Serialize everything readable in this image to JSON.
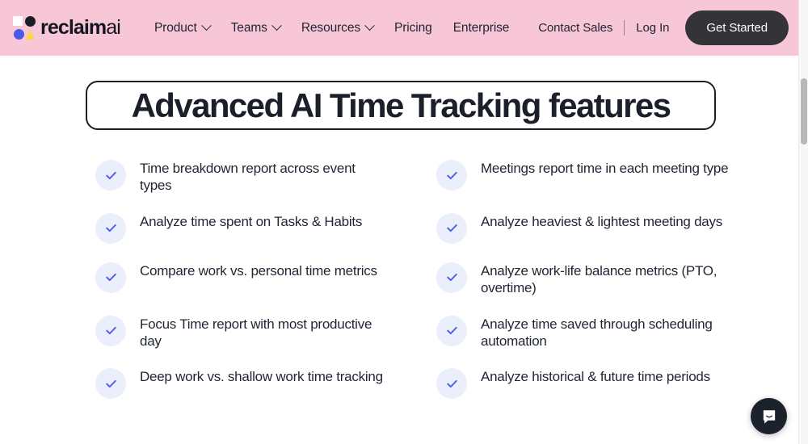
{
  "header": {
    "background_color": "#f7c6d7",
    "logo": {
      "name": "reclaim",
      "suffix": "ai",
      "mark_colors": {
        "square": "#ffffff",
        "circle_dark": "#1a1d26",
        "circle_blue": "#4a5ae8",
        "triangle": "#ffd24d"
      }
    },
    "nav_links": [
      {
        "label": "Product",
        "has_dropdown": true
      },
      {
        "label": "Teams",
        "has_dropdown": true
      },
      {
        "label": "Resources",
        "has_dropdown": true
      },
      {
        "label": "Pricing",
        "has_dropdown": false
      },
      {
        "label": "Enterprise",
        "has_dropdown": false
      }
    ],
    "actions": {
      "contact_sales": "Contact Sales",
      "log_in": "Log In",
      "get_started": "Get Started",
      "cta_background": "#333338"
    }
  },
  "hero": {
    "heading": "Advanced AI Time Tracking features",
    "border_color": "#1b1f2a"
  },
  "features": {
    "check_icon_name": "check-icon",
    "check_color": "#4a5ae8",
    "badge_color": "#ebeefb",
    "items": [
      "Time breakdown report across event types",
      "Meetings report time in each meeting type",
      "Analyze time spent on Tasks & Habits",
      "Analyze heaviest & lightest meeting days",
      "Compare work vs. personal time metrics",
      "Analyze work-life balance metrics (PTO, overtime)",
      "Focus Time report with most productive day",
      "Analyze time saved through scheduling automation",
      "Deep work vs. shallow work time tracking",
      "Analyze historical & future time periods"
    ]
  },
  "widgets": {
    "chat_launcher_name": "chat-bubble-icon",
    "chat_launcher_color": "#1c222c"
  }
}
